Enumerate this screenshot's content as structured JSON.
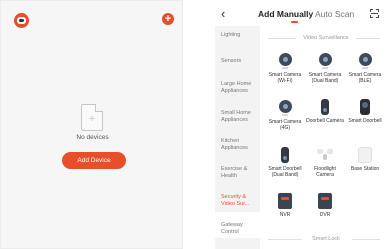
{
  "home": {
    "empty_text": "No devices",
    "add_button": "Add Device"
  },
  "header": {
    "back_label": "‹",
    "tab_active": "Add Manually",
    "tab_inactive": "Auto Scan"
  },
  "sidebar": {
    "items": [
      {
        "label": "Lighting"
      },
      {
        "label": "Sensors"
      },
      {
        "label": "Large Home Appliances"
      },
      {
        "label": "Small Home Appliances"
      },
      {
        "label": "Kitchen Appliances"
      },
      {
        "label": "Exercise & Health"
      },
      {
        "label": "Security & Video Sur..."
      },
      {
        "label": "Gateway Control"
      }
    ],
    "active_index": 6
  },
  "section": {
    "title": "Video Surveillance",
    "next_title": "Smart Lock"
  },
  "devices": [
    {
      "label": "Smart Camera (Wi-Fi)",
      "icon": "camera-icon"
    },
    {
      "label": "Smart Camera (Dual Band)",
      "icon": "camera-icon"
    },
    {
      "label": "Smart Camera (BLE)",
      "icon": "camera-icon"
    },
    {
      "label": "Smart Camera (4G)",
      "icon": "camera-icon"
    },
    {
      "label": "Doorbell Camera",
      "icon": "doorbell-icon"
    },
    {
      "label": "Smart Doorbell",
      "icon": "doorbell-icon"
    },
    {
      "label": "Smart Doorbell (Dual Band)",
      "icon": "doorbell-icon"
    },
    {
      "label": "Floodlight Camera",
      "icon": "floodlight-icon"
    },
    {
      "label": "Base Station",
      "icon": "base-station-icon"
    },
    {
      "label": "NVR",
      "icon": "nvr-icon"
    },
    {
      "label": "DVR",
      "icon": "dvr-icon"
    }
  ],
  "colors": {
    "accent": "#e94e2b"
  }
}
